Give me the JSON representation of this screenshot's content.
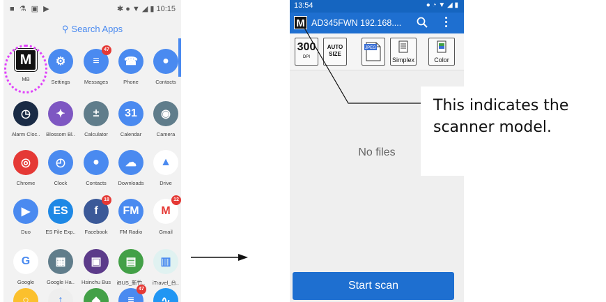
{
  "drawer": {
    "status_left": "■ ⚗ ▣ ▶",
    "status_right": "✱ ● ▼ ◢ ▮ 10:15",
    "search_label": "Search Apps",
    "apps": [
      {
        "label": "MB",
        "icon": "M",
        "color": "#111111",
        "badge": ""
      },
      {
        "label": "Settings",
        "icon": "⚙",
        "color": "#4a8af0",
        "badge": ""
      },
      {
        "label": "Messages",
        "icon": "≡",
        "color": "#4a8af0",
        "badge": "47"
      },
      {
        "label": "Phone",
        "icon": "☎",
        "color": "#4a8af0",
        "badge": ""
      },
      {
        "label": "Contacts",
        "icon": "●",
        "color": "#4a8af0",
        "badge": ""
      },
      {
        "label": "Alarm Cloc..",
        "icon": "◷",
        "color": "#1a2b45",
        "badge": ""
      },
      {
        "label": "Blossom Bl..",
        "icon": "✦",
        "color": "#7e57c2",
        "badge": ""
      },
      {
        "label": "Calculator",
        "icon": "±",
        "color": "#607d8b",
        "badge": ""
      },
      {
        "label": "Calendar",
        "icon": "31",
        "color": "#4a8af0",
        "badge": ""
      },
      {
        "label": "Camera",
        "icon": "◉",
        "color": "#607d8b",
        "badge": ""
      },
      {
        "label": "Chrome",
        "icon": "◎",
        "color": "#e53935",
        "badge": ""
      },
      {
        "label": "Clock",
        "icon": "◴",
        "color": "#4a8af0",
        "badge": ""
      },
      {
        "label": "Contacts",
        "icon": "●",
        "color": "#4a8af0",
        "badge": ""
      },
      {
        "label": "Downloads",
        "icon": "☁",
        "color": "#4a8af0",
        "badge": ""
      },
      {
        "label": "Drive",
        "icon": "▲",
        "color": "#ffffff",
        "badge": ""
      },
      {
        "label": "Duo",
        "icon": "▶",
        "color": "#4a8af0",
        "badge": ""
      },
      {
        "label": "ES File Exp..",
        "icon": "ES",
        "color": "#1e88e5",
        "badge": ""
      },
      {
        "label": "Facebook",
        "icon": "f",
        "color": "#3b5998",
        "badge": "18"
      },
      {
        "label": "FM Radio",
        "icon": "FM",
        "color": "#4a8af0",
        "badge": ""
      },
      {
        "label": "Gmail",
        "icon": "M",
        "color": "#ffffff",
        "badge": "12"
      },
      {
        "label": "Google",
        "icon": "G",
        "color": "#ffffff",
        "badge": ""
      },
      {
        "label": "Google Ha..",
        "icon": "▦",
        "color": "#607d8b",
        "badge": ""
      },
      {
        "label": "Hsinchu Bus",
        "icon": "▣",
        "color": "#5c3b8a",
        "badge": ""
      },
      {
        "label": "iBUS_新竹..",
        "icon": "▤",
        "color": "#43a047",
        "badge": ""
      },
      {
        "label": "iTravel_台..",
        "icon": "▥",
        "color": "#e0f2f1",
        "badge": ""
      },
      {
        "label": "",
        "icon": "○",
        "color": "#fbc02d",
        "badge": ""
      },
      {
        "label": "",
        "icon": "↑",
        "color": "#eeeeee",
        "badge": ""
      },
      {
        "label": "",
        "icon": "◆",
        "color": "#43a047",
        "badge": ""
      },
      {
        "label": "",
        "icon": "≡",
        "color": "#4a8af0",
        "badge": "47"
      },
      {
        "label": "",
        "icon": "∿",
        "color": "#2196f3",
        "badge": ""
      }
    ]
  },
  "scanapp": {
    "status_time": "13:54",
    "status_right": "● ◔ ▼ ◢ ▮",
    "logo": "M",
    "model": "AD345FWN  192.168....",
    "toolbar": {
      "dpi_value": "300",
      "dpi_label": "DPI",
      "size_line1": "AUTO",
      "size_line2": "SIZE",
      "format_label": "JPEG",
      "simplex_label": "Simplex",
      "color_label": "Color"
    },
    "no_files": "No files",
    "start_button": "Start scan"
  },
  "callout": {
    "text": "This indicates the\nscanner model."
  },
  "colors": {
    "accent": "#1e6fd0",
    "highlight_ring": "#e040fb",
    "badge": "#e53935"
  }
}
